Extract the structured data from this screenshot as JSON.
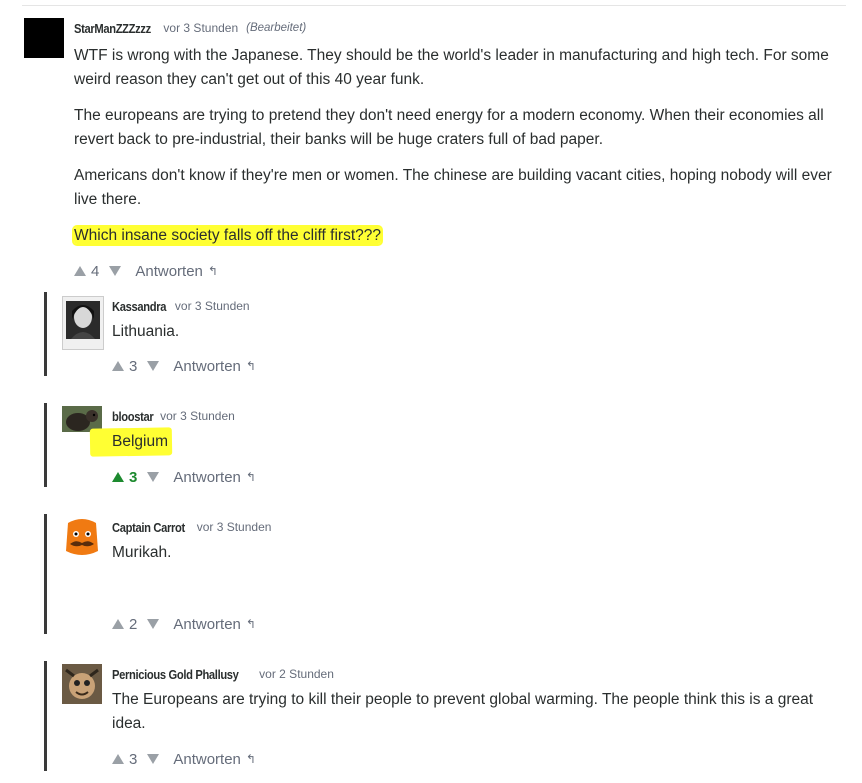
{
  "comments": [
    {
      "author": "StarManZZZzzz",
      "time": "vor 3 Stunden",
      "edited": "(Bearbeitet)",
      "paragraphs": [
        "WTF is wrong with the Japanese.  They should be the world's leader in manufacturing and high tech.  For some weird reason they can't get out of this 40 year funk.",
        "The europeans are trying to pretend they don't need energy for a modern economy.  When their economies all revert back to pre-industrial, their banks will be huge craters full of bad paper.",
        "Americans don't know if they're men or women.  The chinese are building vacant cities, hoping nobody will ever live there.",
        "Which insane society falls off the cliff first???"
      ],
      "votes": "4",
      "reply": "Antworten"
    },
    {
      "author": "Kassandra",
      "time": "vor 3 Stunden",
      "text": "Lithuania.",
      "votes": "3",
      "reply": "Antworten"
    },
    {
      "author": "bloostar",
      "time": "vor 3 Stunden",
      "text": "Belgium",
      "votes": "3",
      "reply": "Antworten",
      "upvoted": true
    },
    {
      "author": "Captain Carrot",
      "time": "vor 3 Stunden",
      "text": "Murikah.",
      "votes": "2",
      "reply": "Antworten"
    },
    {
      "author": "Pernicious Gold Phallusy",
      "time": "vor 2 Stunden",
      "text": "The Europeans are trying to kill their people to prevent global warming. The people think this is a great idea.",
      "votes": "3",
      "reply": "Antworten"
    }
  ],
  "colors": {
    "highlight": "#ffff33",
    "upvote_active": "#1d8a2f"
  }
}
